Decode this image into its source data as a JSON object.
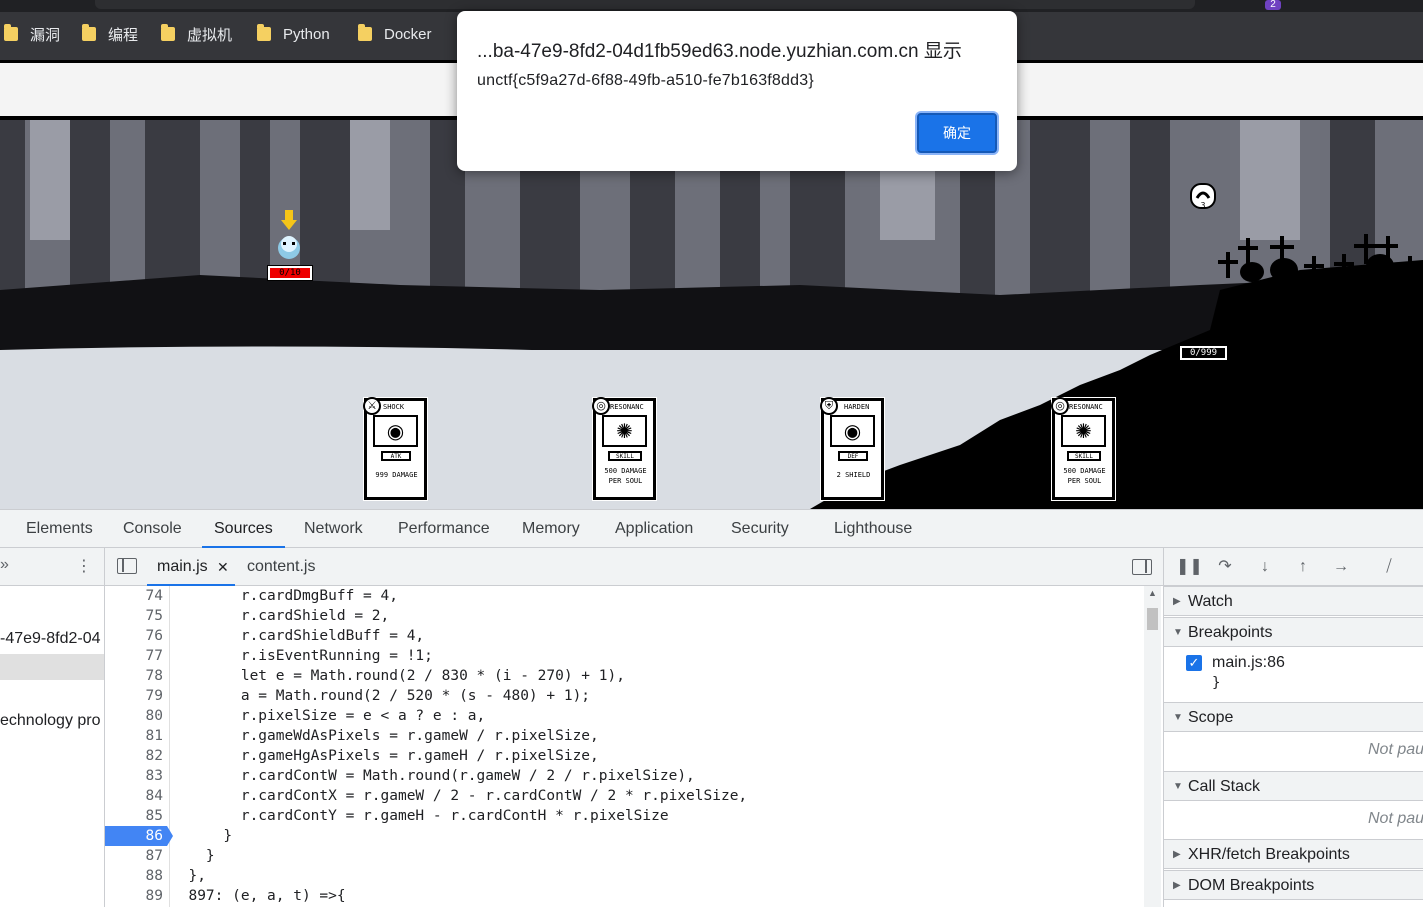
{
  "bookmarks": [
    {
      "label": "漏洞",
      "icon": "folder-icon"
    },
    {
      "label": "编程",
      "icon": "folder-icon"
    },
    {
      "label": "虚拟机",
      "icon": "folder-icon"
    },
    {
      "label": "Python",
      "icon": "folder-icon"
    },
    {
      "label": "Docker",
      "icon": "folder-icon"
    }
  ],
  "extension_badge": "2",
  "alert": {
    "title": "...ba-47e9-8fd2-04d1fb59ed63.node.yuzhian.com.cn 显示",
    "message": "unctf{c5f9a27d-6f88-49fb-a510-fe7b163f8dd3}",
    "ok_label": "确定"
  },
  "game": {
    "player_hp": "0/10",
    "enemy_hp": "0/999",
    "enemy_counter": "3",
    "cards": [
      {
        "name": "SHOCK",
        "type": "ATK",
        "desc1": "999 DAMAGE",
        "desc2": ""
      },
      {
        "name": "RESONANC",
        "type": "SKILL",
        "desc1": "500 DAMAGE",
        "desc2": "PER SOUL"
      },
      {
        "name": "HARDEN",
        "type": "DEF",
        "desc1": "2 SHIELD",
        "desc2": ""
      },
      {
        "name": "RESONANC",
        "type": "SKILL",
        "desc1": "500 DAMAGE",
        "desc2": "PER SOUL"
      }
    ]
  },
  "devtools": {
    "tabs": [
      "Elements",
      "Console",
      "Sources",
      "Network",
      "Performance",
      "Memory",
      "Application",
      "Security",
      "Lighthouse"
    ],
    "active_tab": "Sources",
    "navigator": {
      "host_fragment": "-47e9-8fd2-04",
      "tech_fragment": "echnology pro"
    },
    "open_files": [
      {
        "name": "main.js",
        "closable": true
      },
      {
        "name": "content.js",
        "closable": false
      }
    ],
    "active_file": "main.js",
    "code_lines": [
      {
        "num": "74",
        "text": "        r.cardDmgBuff = 4,"
      },
      {
        "num": "75",
        "text": "        r.cardShield = 2,"
      },
      {
        "num": "76",
        "text": "        r.cardShieldBuff = 4,"
      },
      {
        "num": "77",
        "text": "        r.isEventRunning = !1;"
      },
      {
        "num": "78",
        "text": "        let e = Math.round(2 / 830 * (i - 270) + 1),"
      },
      {
        "num": "79",
        "text": "        a = Math.round(2 / 520 * (s - 480) + 1);"
      },
      {
        "num": "80",
        "text": "        r.pixelSize = e < a ? e : a,"
      },
      {
        "num": "81",
        "text": "        r.gameWdAsPixels = r.gameW / r.pixelSize,"
      },
      {
        "num": "82",
        "text": "        r.gameHgAsPixels = r.gameH / r.pixelSize,"
      },
      {
        "num": "83",
        "text": "        r.cardContW = Math.round(r.gameW / 2 / r.pixelSize),"
      },
      {
        "num": "84",
        "text": "        r.cardContX = r.gameW / 2 - r.cardContW / 2 * r.pixelSize,"
      },
      {
        "num": "85",
        "text": "        r.cardContY = r.gameH - r.cardContH * r.pixelSize"
      },
      {
        "num": "86",
        "text": "      }"
      },
      {
        "num": "87",
        "text": "    }"
      },
      {
        "num": "88",
        "text": "  },"
      },
      {
        "num": "89",
        "text": "  897: (e, a, t) =>{"
      }
    ],
    "breakpoint_line": "86",
    "debugger": {
      "sections": {
        "watch": "Watch",
        "breakpoints": "Breakpoints",
        "scope": "Scope",
        "call_stack": "Call Stack",
        "xhr": "XHR/fetch Breakpoints",
        "dom": "DOM Breakpoints"
      },
      "breakpoint_item": "main.js:86",
      "breakpoint_snippet": "}",
      "not_paused": "Not pau"
    }
  }
}
